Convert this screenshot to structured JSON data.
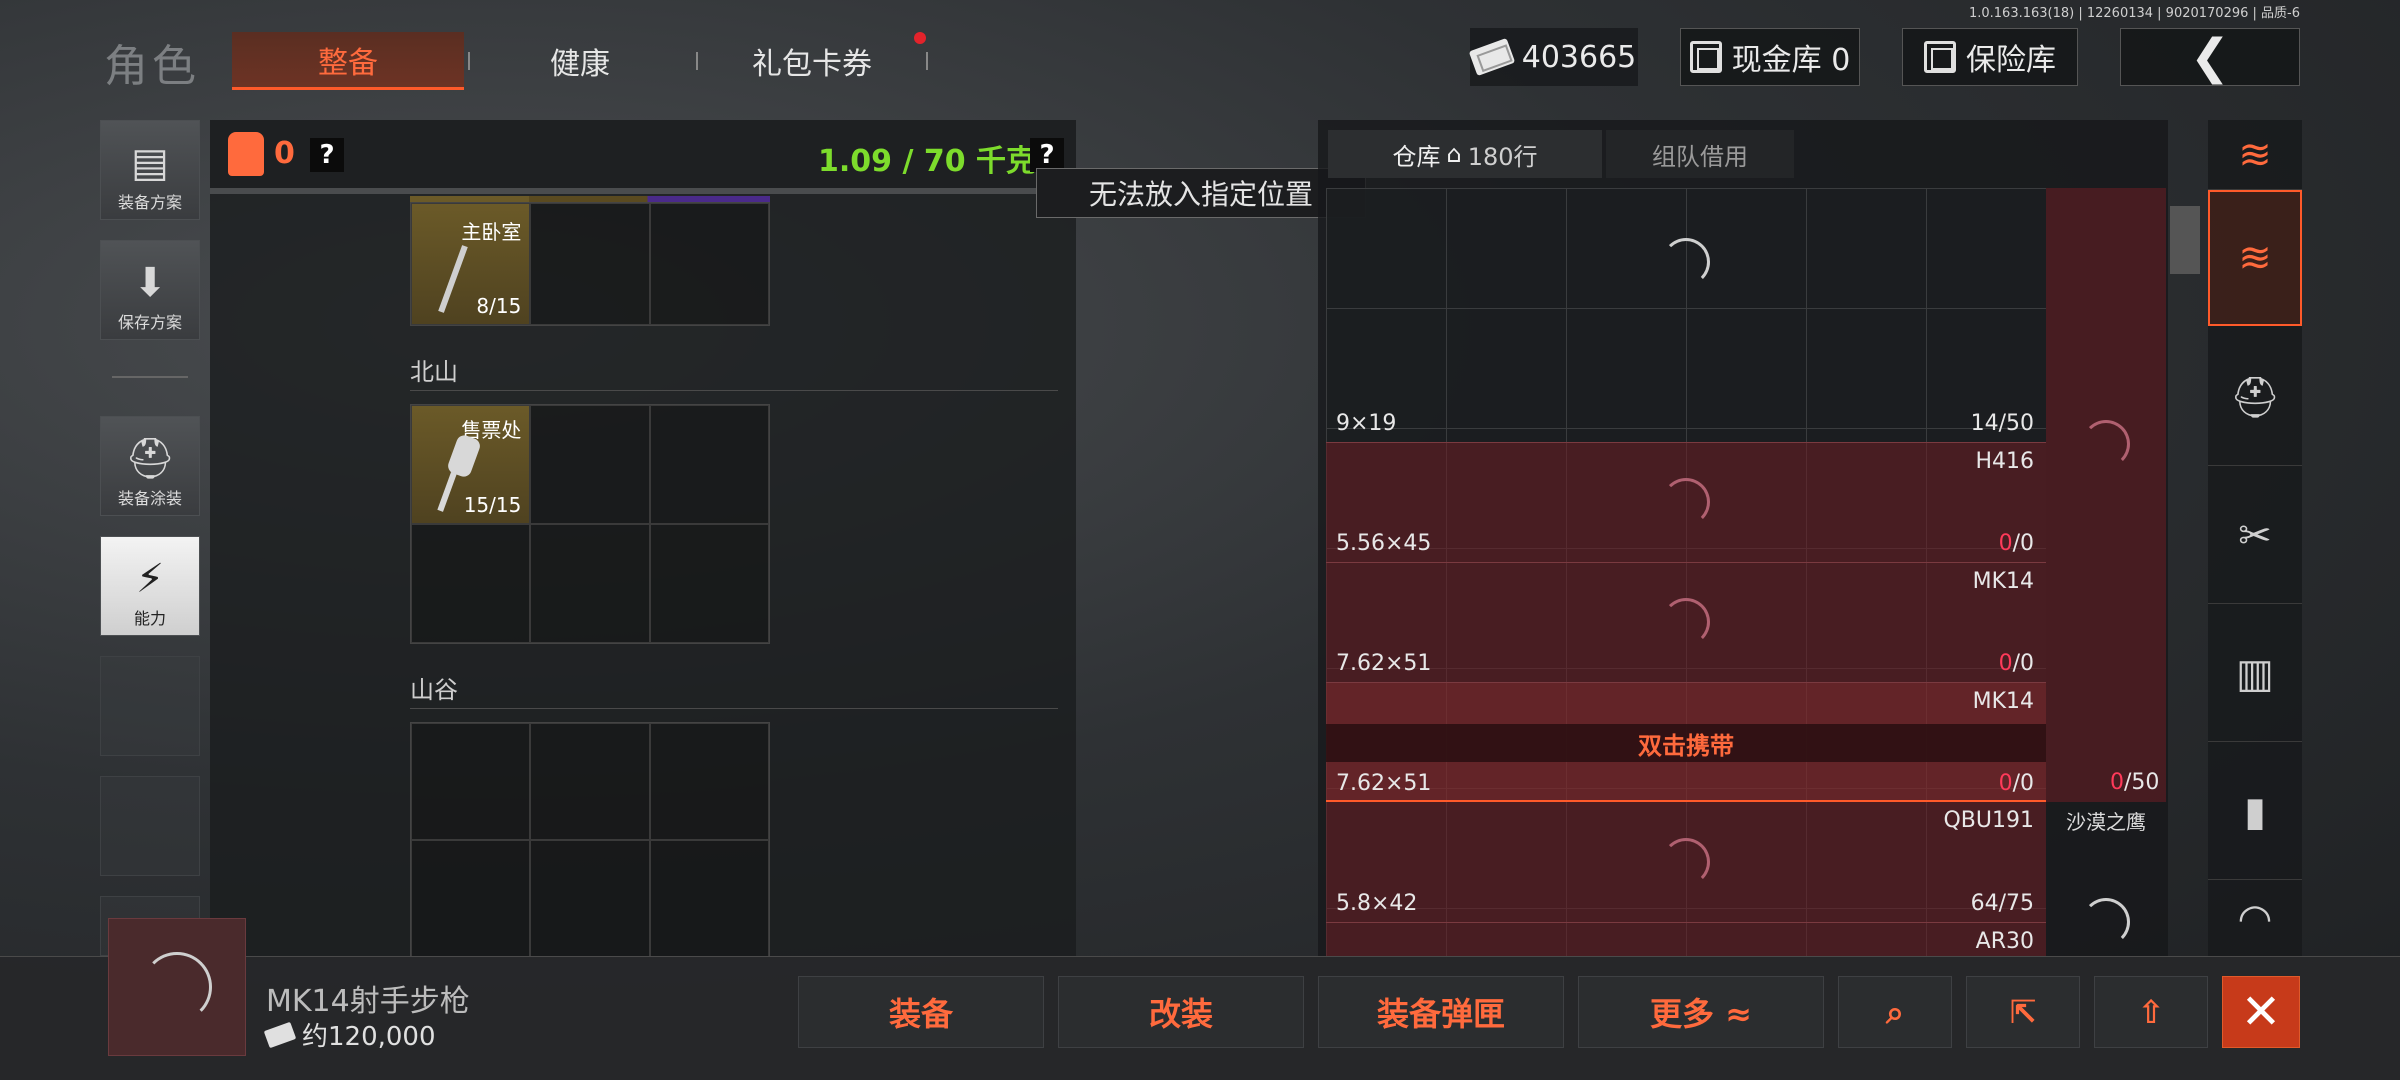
{
  "version": "1.0.163.163(18) | 12260134 | 9020170296 | 品质-6",
  "header": {
    "title": "角色",
    "tabs": [
      {
        "label": "整备",
        "active": true
      },
      {
        "label": "健康",
        "active": false
      },
      {
        "label": "礼包卡券",
        "active": false
      }
    ],
    "currency": "403665",
    "cash_vault": "现金库 0",
    "safe": "保险库",
    "back_icon": "chevron-left-icon"
  },
  "sidebar": {
    "items": [
      {
        "label": "装备方案",
        "icon": "vest-icon"
      },
      {
        "label": "保存方案",
        "icon": "download-icon"
      },
      {
        "label": "装备涂装",
        "icon": "helmet-icon"
      },
      {
        "label": "能力",
        "icon": "lightning-icon"
      }
    ]
  },
  "loadout": {
    "armor_count": "0",
    "help": "?",
    "weight": "1.09 / 70 千克",
    "tooltip": "无法放入指定位置",
    "sections": [
      {
        "label": "",
        "item_name": "主卧室",
        "item_count": "8/15"
      },
      {
        "label": "北山",
        "item_name": "售票处",
        "item_count": "15/15"
      },
      {
        "label": "山谷"
      }
    ]
  },
  "warehouse": {
    "tabs": [
      {
        "label": "仓库",
        "extra": "180行"
      },
      {
        "label": "组队借用"
      }
    ],
    "rows": [
      {
        "name": "",
        "caliber": "9×19",
        "count_a": "14",
        "count_b": "/50",
        "zero": false
      },
      {
        "name": "H416",
        "caliber": "5.56×45",
        "count_a": "0",
        "count_b": "/0",
        "zero": true
      },
      {
        "name": "MK14",
        "caliber": "7.62×51",
        "count_a": "0",
        "count_b": "/0",
        "zero": true
      },
      {
        "name": "MK14",
        "caliber": "7.62×51",
        "count_a": "0",
        "count_b": "/0",
        "zero": true
      },
      {
        "name": "QBU191",
        "caliber": "5.8×42",
        "count_a": "64",
        "count_b": "/75",
        "zero": false
      },
      {
        "name": "AR30",
        "caliber": "",
        "count_a": "",
        "count_b": "",
        "zero": false
      }
    ],
    "double_click_hint": "双击携带",
    "side_count_a": "0",
    "side_count_b": "/50",
    "side_name": "沙漠之鹰"
  },
  "right_column": {
    "icons": [
      "stack-refresh-icon",
      "stack-sort-icon",
      "helmet-icon",
      "rifle-icon",
      "magazine-icon",
      "bullet-icon"
    ]
  },
  "bottom": {
    "item_title": "MK14射手步枪",
    "item_price": "约120,000",
    "buttons": {
      "equip": "装备",
      "modify": "改装",
      "equip_mag": "装备弹匣",
      "more": "更多 ≈"
    }
  },
  "colors": {
    "accent": "#ff6a3d",
    "weight_green": "#7ddc2c",
    "zero_red": "#ff3a5a"
  }
}
